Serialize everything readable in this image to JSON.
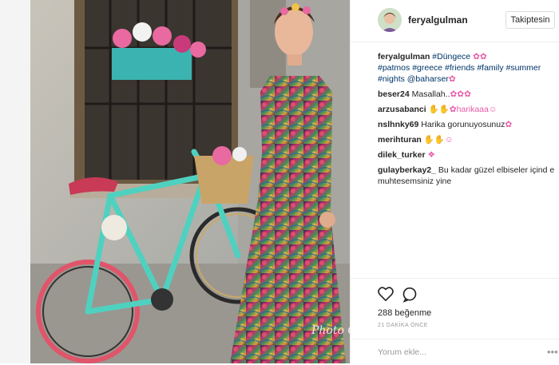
{
  "post": {
    "username": "feryalgulman",
    "follow_label": "Takiptesin",
    "caption_user": "feryalgulman",
    "caption_line1": "#Düngece",
    "caption_emoji1": "✿✿",
    "caption_line2": "#patmos #greece #friends #family #summer",
    "caption_line3": "#nights @baharser",
    "caption_emoji2": "✿"
  },
  "comments": [
    {
      "user": "beser24",
      "text": "Masallah..",
      "emoji": "✿✿✿"
    },
    {
      "user": "arzusabanci",
      "text": "",
      "emoji": "✋✋✿harikaaa☺"
    },
    {
      "user": "nslhnky69",
      "text": "Harika gorunuyosunuz",
      "emoji": "✿"
    },
    {
      "user": "merihturan",
      "text": "",
      "emoji": "✋✋☺"
    },
    {
      "user": "dilek_turker",
      "text": "",
      "emoji": "❖"
    },
    {
      "user": "gulayberkay2_",
      "text": "Bu kadar güzel elbiseler içind e muhtesemsiniz yine",
      "emoji": ""
    }
  ],
  "actions": {
    "likes": "288 beğenme",
    "time": "21 DAKİKA ÖNCE",
    "comment_placeholder": "Yorum ekle...",
    "more": "•••"
  },
  "photo": {
    "watermark": "Photo Gut"
  },
  "icons": [
    "heart-icon",
    "comment-icon",
    "more-options-icon"
  ]
}
